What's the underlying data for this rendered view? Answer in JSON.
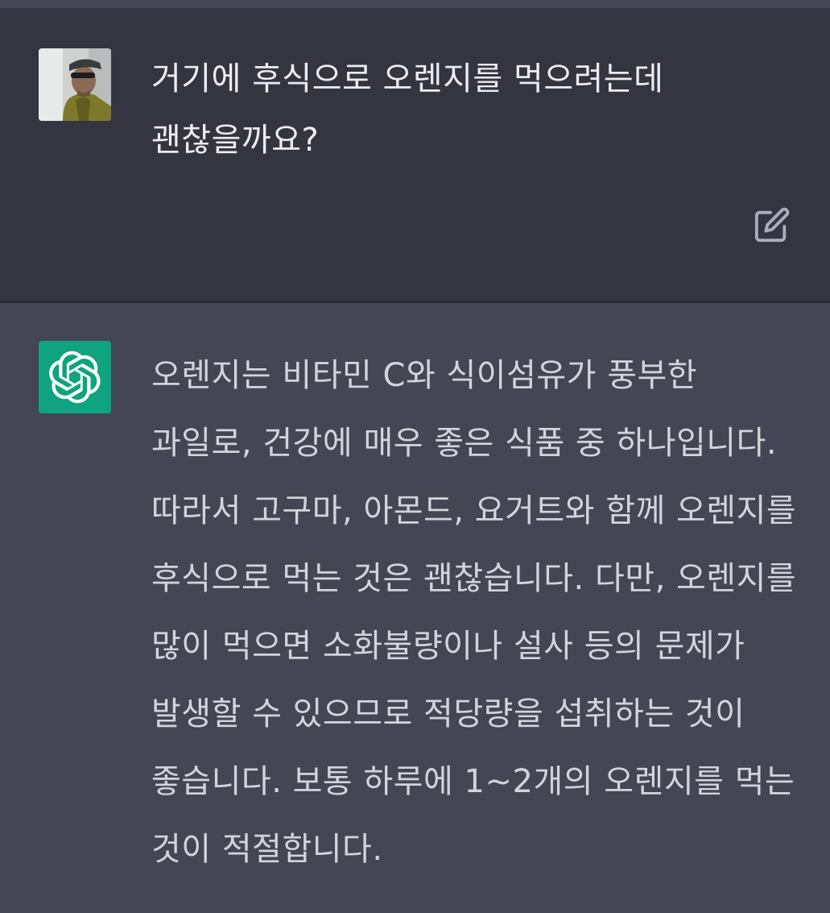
{
  "user_message": {
    "text": "거기에 후식으로 오렌지를 먹으려는데 괜찮을까요?",
    "edit_icon": "edit-icon"
  },
  "assistant_message": {
    "text": "오렌지는 비타민 C와 식이섬유가 풍부한 과일로, 건강에 매우 좋은 식품 중 하나입니다. 따라서 고구마, 아몬드, 요거트와 함께 오렌지를 후식으로 먹는 것은 괜찮습니다. 다만, 오렌지를 많이 먹으면 소화불량이나 설사 등의 문제가 발생할 수 있으므로 적당량을 섭취하는 것이 좋습니다. 보통 하루에 1~2개의 오렌지를 먹는 것이 적절합니다.",
    "avatar_icon": "openai-logo-icon"
  },
  "colors": {
    "user_bg": "#343541",
    "assistant_bg": "#444654",
    "bot_avatar_bg": "#10a37f",
    "text": "#ececf1"
  }
}
